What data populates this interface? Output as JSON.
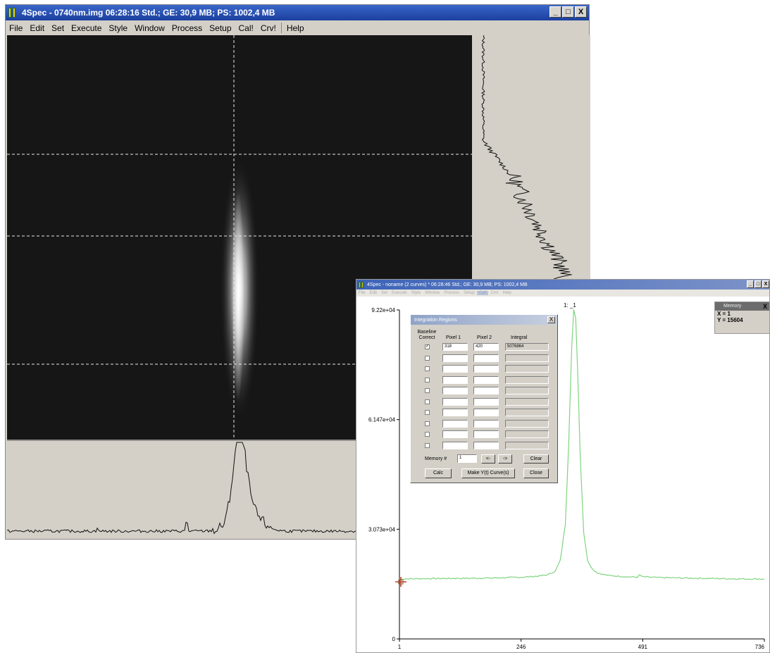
{
  "main_window": {
    "title": "4Spec - 0740nm.img  06:28:16 Std.; GE: 30,9 MB; PS: 1002,4 MB",
    "controls": [
      "_",
      "□",
      "X"
    ],
    "menu": [
      "File",
      "Edit",
      "Set",
      "Execute",
      "Style",
      "Window",
      "Process",
      "Setup",
      "Cal!",
      "Crv!",
      "Help"
    ]
  },
  "plot_window": {
    "title": "4Spec - noname (2 curves) *  06:28:46 Std.; GE: 30,9 MB; PS: 1002,4 MB",
    "controls": [
      "_",
      "□",
      "X"
    ],
    "menu": [
      "File",
      "Edit",
      "Set",
      "Execute",
      "Style",
      "Window",
      "Process",
      "Setup",
      "Cal!",
      "Crv!",
      "Help"
    ],
    "curve_label": "1: _1",
    "accent_color": "#7fd37f"
  },
  "chart_data": {
    "type": "line",
    "title": "",
    "xlabel": "",
    "ylabel": "",
    "x_ticks": [
      "1",
      "246",
      "491",
      "736"
    ],
    "y_ticks": [
      "0",
      "3.073e+04",
      "6.147e+04",
      "9.22e+04"
    ],
    "xlim": [
      1,
      736
    ],
    "ylim": [
      0,
      92200
    ],
    "series": [
      {
        "name": "1: _1",
        "color": "#7fd37f",
        "x": [
          1,
          50,
          100,
          150,
          200,
          250,
          280,
          300,
          315,
          325,
          335,
          342,
          348,
          352,
          356,
          360,
          365,
          372,
          380,
          390,
          400,
          420,
          460,
          480,
          485,
          490,
          520,
          560,
          600,
          650,
          700,
          736
        ],
        "y": [
          16800,
          16900,
          16950,
          17000,
          17100,
          17300,
          17600,
          18000,
          19000,
          22000,
          32000,
          55000,
          82000,
          92200,
          90000,
          75000,
          52000,
          30000,
          22000,
          19500,
          18500,
          17800,
          17400,
          17300,
          17900,
          17400,
          17200,
          17100,
          17000,
          16900,
          16800,
          16800
        ]
      }
    ]
  },
  "integration_dialog": {
    "title": "Integration Regions",
    "close": "X",
    "headers": [
      "Baseline Correct",
      "Pixel 1",
      "Pixel 2",
      "Integral"
    ],
    "rows": [
      {
        "checked": "✓",
        "pixel1": "318",
        "pixel2": "420",
        "integral": "5076864"
      },
      {
        "checked": "",
        "pixel1": "",
        "pixel2": "",
        "integral": ""
      },
      {
        "checked": "",
        "pixel1": "",
        "pixel2": "",
        "integral": ""
      },
      {
        "checked": "",
        "pixel1": "",
        "pixel2": "",
        "integral": ""
      },
      {
        "checked": "",
        "pixel1": "",
        "pixel2": "",
        "integral": ""
      },
      {
        "checked": "",
        "pixel1": "",
        "pixel2": "",
        "integral": ""
      },
      {
        "checked": "",
        "pixel1": "",
        "pixel2": "",
        "integral": ""
      },
      {
        "checked": "",
        "pixel1": "",
        "pixel2": "",
        "integral": ""
      },
      {
        "checked": "",
        "pixel1": "",
        "pixel2": "",
        "integral": ""
      },
      {
        "checked": "",
        "pixel1": "",
        "pixel2": "",
        "integral": ""
      }
    ],
    "memory_label": "Memory #",
    "memory_value": "1",
    "prev_button": "<-",
    "next_button": "->",
    "clear_button": "Clear",
    "calc_button": "Calc",
    "make_curve_button": "Make Y(t) Curve(s)",
    "close_button": "Close"
  },
  "memory_panel": {
    "title": "Memory",
    "close": "X",
    "x_readout": "X = 1",
    "y_readout": "Y = 15604"
  }
}
